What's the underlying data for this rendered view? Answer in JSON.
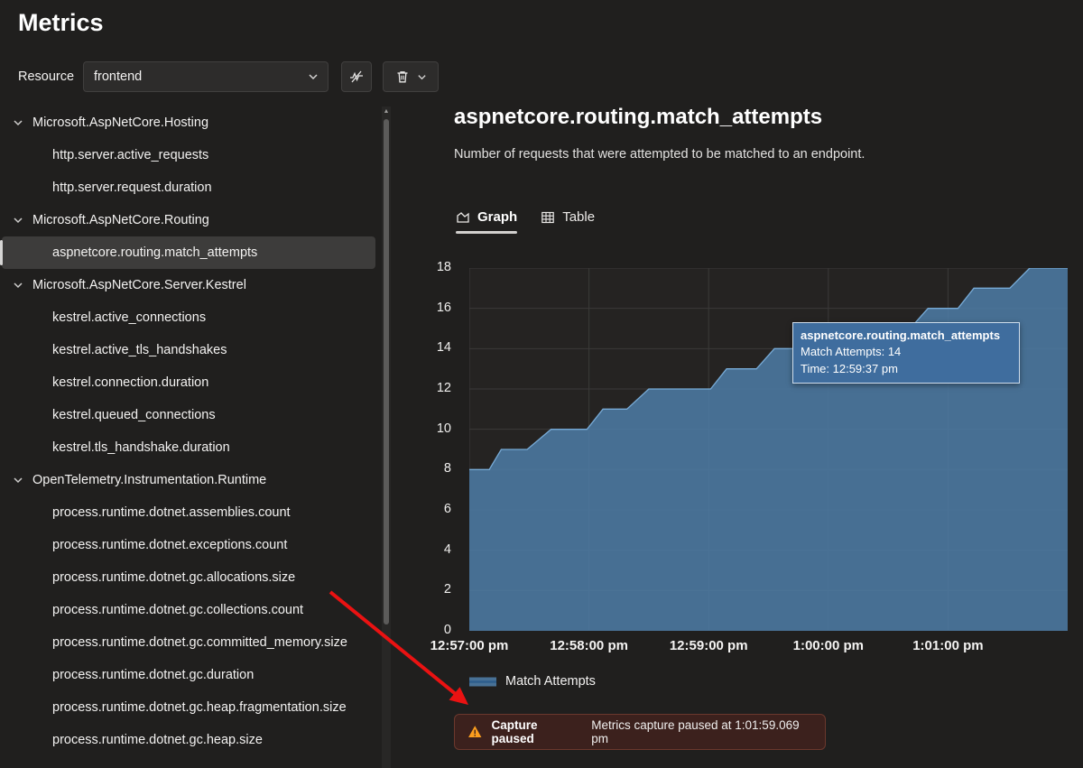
{
  "header": {
    "title": "Metrics"
  },
  "toolbar": {
    "resource_label": "Resource",
    "resource_value": "frontend",
    "icons": {
      "resource_dropdown": "chevron-down-icon",
      "pause_button": "crossed-out-pulse-icon",
      "remove_button": "trash-icon",
      "remove_dropdown": "chevron-down-icon"
    }
  },
  "sidebar": {
    "selected_item": "aspnetcore.routing.match_attempts",
    "groups": [
      {
        "label": "Microsoft.AspNetCore.Hosting",
        "items": [
          "http.server.active_requests",
          "http.server.request.duration"
        ]
      },
      {
        "label": "Microsoft.AspNetCore.Routing",
        "items": [
          "aspnetcore.routing.match_attempts"
        ]
      },
      {
        "label": "Microsoft.AspNetCore.Server.Kestrel",
        "items": [
          "kestrel.active_connections",
          "kestrel.active_tls_handshakes",
          "kestrel.connection.duration",
          "kestrel.queued_connections",
          "kestrel.tls_handshake.duration"
        ]
      },
      {
        "label": "OpenTelemetry.Instrumentation.Runtime",
        "items": [
          "process.runtime.dotnet.assemblies.count",
          "process.runtime.dotnet.exceptions.count",
          "process.runtime.dotnet.gc.allocations.size",
          "process.runtime.dotnet.gc.collections.count",
          "process.runtime.dotnet.gc.committed_memory.size",
          "process.runtime.dotnet.gc.duration",
          "process.runtime.dotnet.gc.heap.fragmentation.size",
          "process.runtime.dotnet.gc.heap.size"
        ]
      }
    ]
  },
  "main": {
    "title": "aspnetcore.routing.match_attempts",
    "subtitle": "Number of requests that were attempted to be matched to an endpoint.",
    "tabs": [
      {
        "label": "Graph",
        "selected": true
      },
      {
        "label": "Table",
        "selected": false
      }
    ]
  },
  "chart_data": {
    "type": "area",
    "title": "aspnetcore.routing.match_attempts",
    "ylim": [
      0,
      18
    ],
    "y_ticks": [
      0,
      2,
      4,
      6,
      8,
      10,
      12,
      14,
      16,
      18
    ],
    "x_range_seconds": [
      0,
      300
    ],
    "x_ticks": [
      {
        "t": 0,
        "label": "12:57:00 pm"
      },
      {
        "t": 60,
        "label": "12:58:00 pm"
      },
      {
        "t": 120,
        "label": "12:59:00 pm"
      },
      {
        "t": 180,
        "label": "1:00:00 pm"
      },
      {
        "t": 240,
        "label": "1:01:00 pm"
      }
    ],
    "grid": true,
    "legend_position": "bottom",
    "colors": {
      "plot_bg": "#252322",
      "grid": "#3b3a39",
      "axis": "#55534f"
    },
    "series": [
      {
        "name": "Match Attempts",
        "fill_color": "#4c7aa3",
        "line_color": "#77aad6",
        "points": [
          [
            0,
            8
          ],
          [
            10,
            8
          ],
          [
            16,
            9
          ],
          [
            29,
            9
          ],
          [
            41,
            10
          ],
          [
            59,
            10
          ],
          [
            67,
            11
          ],
          [
            79,
            11
          ],
          [
            90,
            12
          ],
          [
            121,
            12
          ],
          [
            129,
            13
          ],
          [
            144,
            13
          ],
          [
            153,
            14
          ],
          [
            197,
            14
          ],
          [
            206,
            15
          ],
          [
            221,
            15
          ],
          [
            230,
            16
          ],
          [
            245,
            16
          ],
          [
            253,
            17
          ],
          [
            271,
            17
          ],
          [
            281,
            18
          ],
          [
            300,
            18
          ]
        ]
      }
    ]
  },
  "tooltip": {
    "title": "aspnetcore.routing.match_attempts",
    "value": "Match Attempts: 14",
    "time": "Time: 12:59:37 pm"
  },
  "banner": {
    "title": "Capture paused",
    "message": "Metrics capture paused at 1:01:59.069 pm",
    "icon_color": "#fb9e1e"
  },
  "annotation": {
    "arrow_color": "#ea1212"
  }
}
